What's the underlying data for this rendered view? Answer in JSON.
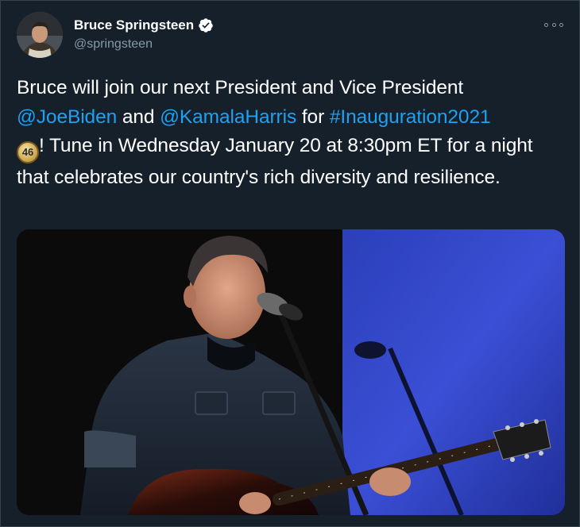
{
  "tweet": {
    "author": {
      "display_name": "Bruce Springsteen",
      "handle": "@springsteen",
      "verified": true,
      "avatar_icon": "avatar-photo"
    },
    "text": {
      "line1": "Bruce will join our next President and Vice President",
      "mention1": "@JoeBiden",
      "and": " and ",
      "mention2": "@KamalaHarris",
      "for": " for ",
      "hashtag": "#Inauguration2021",
      "emoji_label": "46",
      "rest": "! Tune in Wednesday January 20 at 8:30pm ET for a night that celebrates our country's rich diversity and resilience."
    },
    "media": {
      "type": "photo",
      "icon": "photo-image"
    }
  },
  "colors": {
    "background": "#15202b",
    "text": "#ffffff",
    "link": "#1da1f2",
    "muted": "#8899a6",
    "verified": "#ffffff"
  }
}
